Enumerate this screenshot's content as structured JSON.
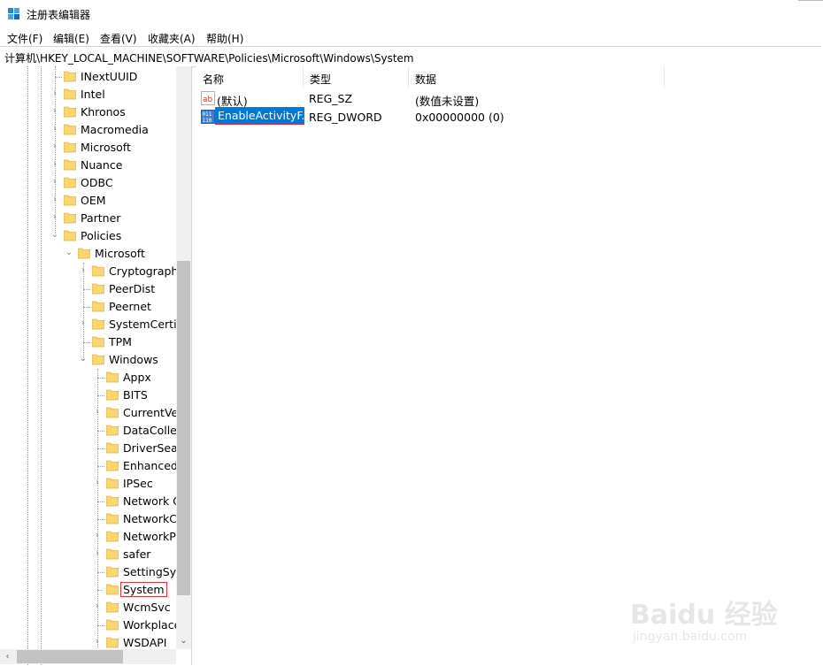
{
  "window": {
    "title": "注册表编辑器"
  },
  "menu": [
    "文件(F)",
    "编辑(E)",
    "查看(V)",
    "收藏夹(A)",
    "帮助(H)"
  ],
  "address": "计算机\\HKEY_LOCAL_MACHINE\\SOFTWARE\\Policies\\Microsoft\\Windows\\System",
  "tree": {
    "level1": [
      "INextUUID",
      "Intel",
      "Khronos",
      "Macromedia",
      "Microsoft",
      "Nuance",
      "ODBC",
      "OEM",
      "Partner",
      "Policies"
    ],
    "level2": [
      "Microsoft"
    ],
    "level3": [
      "Cryptography",
      "PeerDist",
      "Peernet",
      "SystemCertifi",
      "TPM",
      "Windows"
    ],
    "level4": [
      "Appx",
      "BITS",
      "CurrentVe",
      "DataCollec",
      "DriverSear",
      "EnhancedS",
      "IPSec",
      "Network C",
      "NetworkC",
      "NetworkPr",
      "safer",
      "SettingSyn",
      "System",
      "WcmSvc",
      "Workplace",
      "WSDAPI"
    ]
  },
  "columns": [
    "名称",
    "类型",
    "数据"
  ],
  "values": [
    {
      "name": "(默认)",
      "type": "REG_SZ",
      "data": "(数值未设置)"
    },
    {
      "name": "EnableActivityF...",
      "type": "REG_DWORD",
      "data": "0x00000000 (0)"
    }
  ],
  "watermark": {
    "brand": "Baidu 经验",
    "url": "jingyan.baidu.com"
  }
}
